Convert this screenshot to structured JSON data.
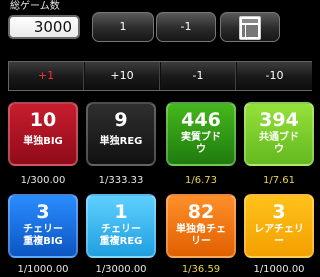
{
  "total": {
    "label": "総ゲーム数",
    "value": "3000"
  },
  "top_buttons": {
    "one": "1",
    "minus_one": "-1",
    "calculator_icon": "calculator-icon"
  },
  "adjust": [
    "+1",
    "+10",
    "-1",
    "-10"
  ],
  "counters_row1": [
    {
      "count": "10",
      "label": "単独BIG",
      "ratio": "1/300.00",
      "color": "#b00f1f"
    },
    {
      "count": "9",
      "label": "単独REG",
      "ratio": "1/333.33",
      "color": "#1c1c1c"
    },
    {
      "count": "446",
      "label": "実質ブド\nウ",
      "ratio": "1/6.73",
      "color": "#2f9a14"
    },
    {
      "count": "394",
      "label": "共通ブド\nウ",
      "ratio": "1/7.61",
      "color": "#7ed32a"
    }
  ],
  "counters_row2": [
    {
      "count": "3",
      "label": "チェリー\n重複BIG",
      "ratio": "1/1000.00",
      "color": "#1976e8"
    },
    {
      "count": "1",
      "label": "チェリー\n重複REG",
      "ratio": "1/3000.00",
      "color": "#39b6ee"
    },
    {
      "count": "82",
      "label": "単独角チェ\nリー",
      "ratio": "1/36.59",
      "color": "#ff7a14"
    },
    {
      "count": "3",
      "label": "レアチェリ\nー",
      "ratio": "1/1000.00",
      "color": "#ffb400"
    }
  ]
}
